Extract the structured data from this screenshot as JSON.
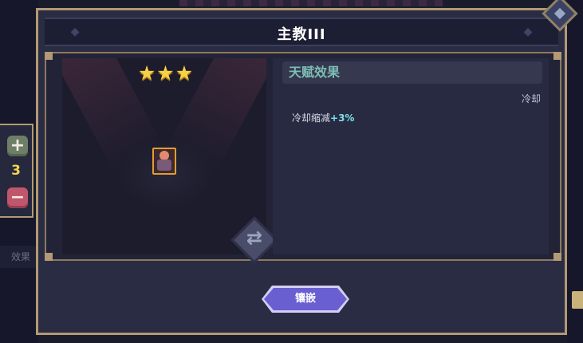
{
  "backdrop": {
    "bottom_left_tab": "效果"
  },
  "side_panel": {
    "plus_symbol": "+",
    "count": "3",
    "minus_symbol": "−"
  },
  "dialog": {
    "title": "主教III",
    "left": {
      "stars": "★★★",
      "star_rating": 3
    },
    "right": {
      "header": "天赋效果",
      "category": "冷却",
      "effect_label": "冷却缩减",
      "effect_value": "+3%"
    },
    "embed_button_label": "镶嵌"
  },
  "colors": {
    "accent_button": "#6a5fd0",
    "frame_gold": "#b39a74",
    "talent_header_text": "#7dbdb5",
    "effect_value": "#7de0ea",
    "star": "#f6d147"
  }
}
